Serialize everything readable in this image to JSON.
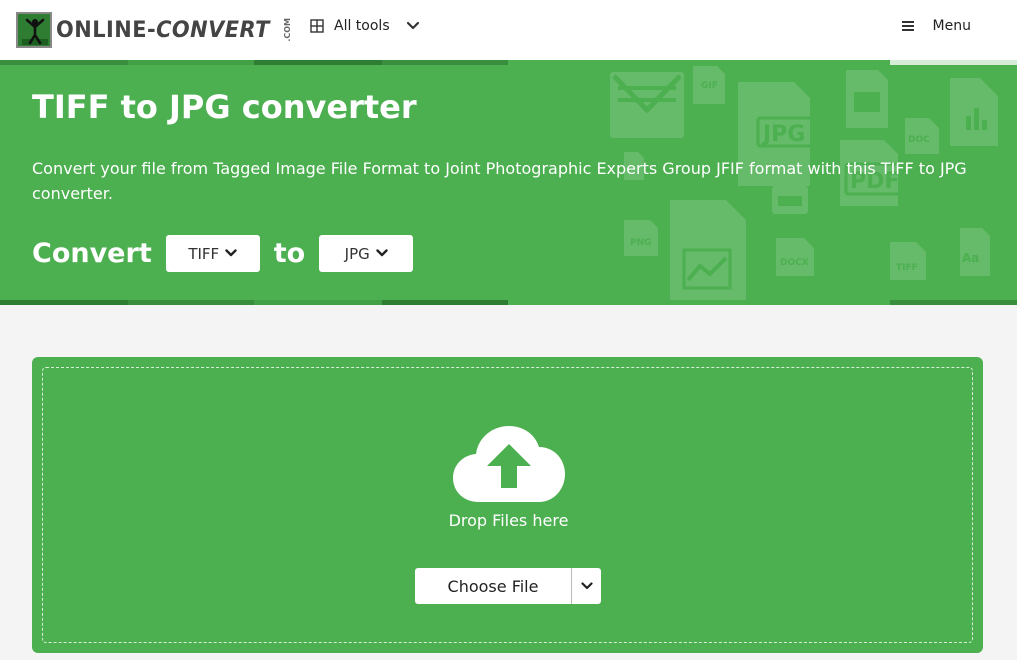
{
  "header": {
    "logo_text_a": "ONLINE-",
    "logo_text_b": "CONVERT",
    "logo_com": ".COM",
    "all_tools_label": "All tools",
    "menu_label": "Menu"
  },
  "hero": {
    "title": "TIFF to JPG converter",
    "description": "Convert your file from Tagged Image File Format to Joint Photographic Experts Group JFIF format with this TIFF to JPG converter.",
    "convert_label": "Convert",
    "to_label": "to",
    "from_format": "TIFF",
    "to_format": "JPG",
    "bg_icon_labels": {
      "gif": "GIF",
      "jpg": "JPG",
      "pdf": "PDF",
      "png": "PNG",
      "docx": "DOCX",
      "tiff": "TIFF",
      "font": "Aa",
      "doc": "DOC"
    }
  },
  "dropzone": {
    "drop_text": "Drop Files here",
    "choose_label": "Choose File"
  },
  "colors": {
    "green": "#4caf50",
    "dark_green": "#2e7d32",
    "light_green": "#6bc06e"
  }
}
